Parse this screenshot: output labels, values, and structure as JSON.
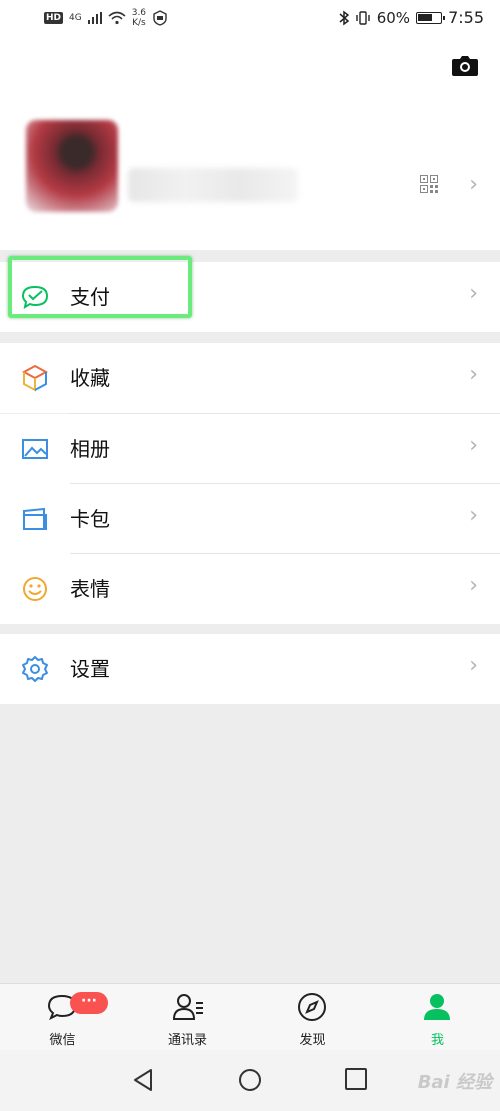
{
  "status_bar": {
    "hd": "HD",
    "net": "4G",
    "speed_top": "3.6",
    "speed_bottom": "K/s",
    "battery_pct": "60%",
    "time": "7:55"
  },
  "menu": {
    "pay": "支付",
    "favorites": "收藏",
    "album": "相册",
    "cards": "卡包",
    "stickers": "表情",
    "settings": "设置"
  },
  "tabs": [
    {
      "label": "微信",
      "badge": "···"
    },
    {
      "label": "通讯录"
    },
    {
      "label": "发现"
    },
    {
      "label": "我"
    }
  ],
  "watermark": "Bai 经验",
  "colors": {
    "accent": "#07c160",
    "badge": "#fa5151",
    "highlight": "#6bea7e"
  }
}
